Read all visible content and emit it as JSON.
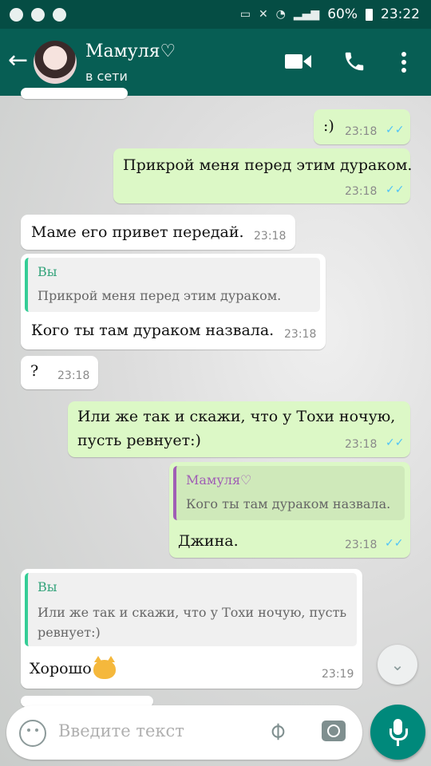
{
  "status_bar": {
    "battery": "60%",
    "time": "23:22"
  },
  "header": {
    "contact_name": "Мамуля♡",
    "contact_status": "в сети"
  },
  "messages": [
    {
      "direction": "out",
      "text": ":)",
      "time": "23:18",
      "read": true
    },
    {
      "direction": "out",
      "text": "Прикрой меня перед этим дураком.",
      "time": "23:18",
      "read": true
    },
    {
      "direction": "in",
      "text": "Маме его привет передай.",
      "time": "23:18"
    },
    {
      "direction": "in",
      "quote": {
        "author": "Вы",
        "text": "Прикрой меня перед этим дураком."
      },
      "text": "Кого ты там дураком назвала.",
      "time": "23:18"
    },
    {
      "direction": "in",
      "text": "?",
      "time": "23:18"
    },
    {
      "direction": "out",
      "text_lines": [
        "Или же так и скажи, что у Тохи ночую,",
        "пусть ревнует:)"
      ],
      "time": "23:18",
      "read": true
    },
    {
      "direction": "out",
      "quote": {
        "author": "Мамуля♡",
        "text": "Кого ты там дураком назвала."
      },
      "text": "Джина.",
      "time": "23:18",
      "read": true
    },
    {
      "direction": "in",
      "quote": {
        "author": "Вы",
        "text_lines": [
          "Или же так и скажи, что у Тохи ночую, пусть",
          "ревнует:)"
        ]
      },
      "text": "Хорошо",
      "time": "23:19"
    }
  ],
  "composer": {
    "placeholder": "Введите текст"
  },
  "colors": {
    "header": "#075e54",
    "status_bar": "#054d44",
    "outgoing_bubble": "#dcf8c6",
    "incoming_bubble": "#ffffff",
    "read_ticks": "#4fc3f7",
    "send_button": "#00897b"
  },
  "icons": [
    "back-arrow-icon",
    "video-call-icon",
    "phone-icon",
    "more-vert-icon",
    "emoji-icon",
    "attach-icon",
    "camera-icon",
    "mic-icon",
    "scroll-down-icon",
    "grinning-cat-emoji"
  ]
}
